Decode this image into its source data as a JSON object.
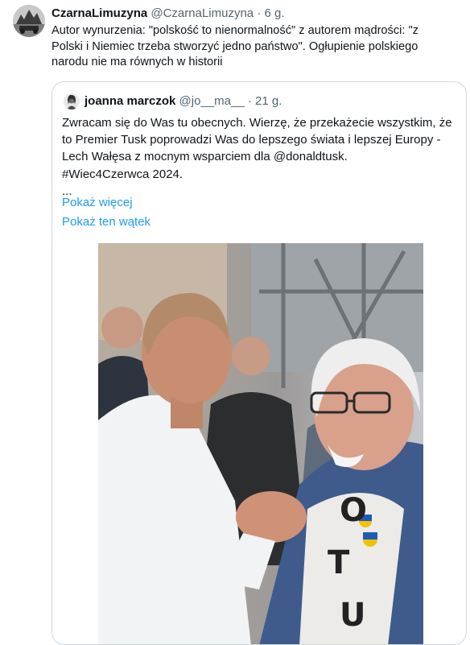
{
  "tweet": {
    "author_name": "CzarnaLimuzyna",
    "author_handle": "@CzarnaLimuzyna",
    "separator": "·",
    "time": "6 g.",
    "text_lines": [
      "Autor wynurzenia: \"polskość to nienormalność\" z autorem mądrości: \"z",
      "Polski i Niemiec trzeba stworzyć jedno państwo\". Ogłupienie polskiego",
      "narodu nie ma równych w historii"
    ]
  },
  "quote": {
    "author_name": "joanna marczok",
    "author_handle": "@jo__ma__",
    "separator": "·",
    "time": "21 g.",
    "text_lines": [
      "Zwracam się do Was tu obecnych. Wierzę, że przekażecie wszystkim, że",
      "to Premier Tusk poprowadzi Was do lepszego świata i lepszej Europy -",
      "Lech Wałęsa z mocnym wsparciem dla @donaldtusk.",
      "#Wiec4Czerwca 2024.",
      "..."
    ],
    "show_more": "Pokaż więcej",
    "show_thread": "Pokaż ten wątek"
  },
  "photo": {
    "shirt_letters": [
      "O",
      "T",
      "U"
    ]
  },
  "colors": {
    "link": "#1d9bf0",
    "secondary_text": "#536471",
    "border": "#cfd9de"
  }
}
